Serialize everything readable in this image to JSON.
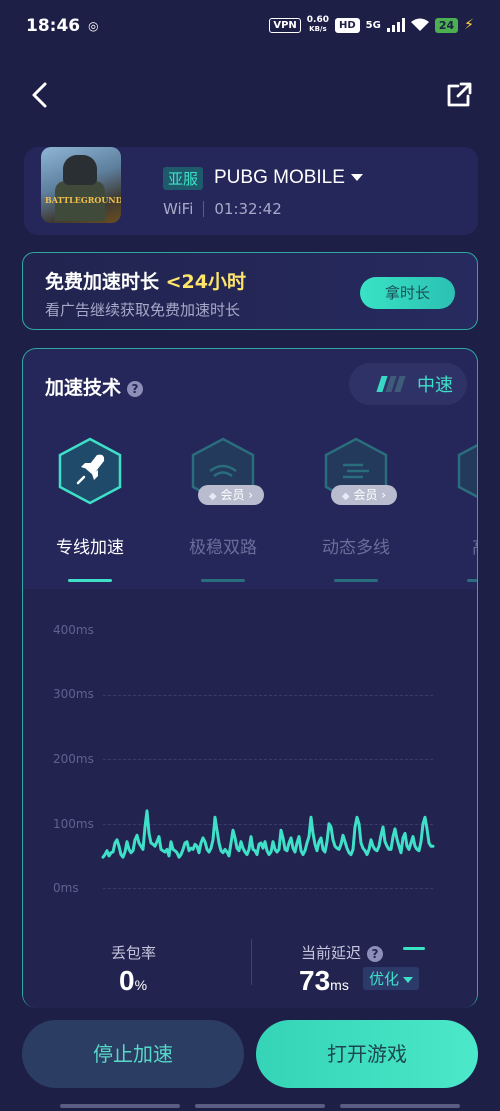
{
  "status_bar": {
    "time": "18:46",
    "vpn": "VPN",
    "net_speed": "0.60",
    "net_unit": "KB/s",
    "hd": "HD",
    "signal": "5G",
    "battery": "24"
  },
  "game": {
    "region": "亚服",
    "name": "PUBG MOBILE",
    "network": "WiFi",
    "duration": "01:32:42",
    "icon_text": "BATTLEGROUNDS"
  },
  "free_time": {
    "title_prefix": "免费加速时长 ",
    "title_highlight": "<24小时",
    "subtitle": "看广告继续获取免费加速时长",
    "button": "拿时长"
  },
  "tech": {
    "title": "加速技术",
    "help": "?",
    "speed_mode": "中速",
    "items": [
      {
        "label": "专线加速"
      },
      {
        "label": "极稳双路",
        "badge": "会员"
      },
      {
        "label": "动态多线",
        "badge": "会员"
      },
      {
        "label": "高速"
      }
    ]
  },
  "chart_data": {
    "type": "line",
    "y_ticks": [
      "400ms",
      "300ms",
      "200ms",
      "100ms",
      "0ms"
    ],
    "ylim": [
      0,
      400
    ],
    "series": [
      {
        "values": [
          48,
          52,
          58,
          50,
          55,
          56,
          70,
          75,
          65,
          52,
          48,
          56,
          72,
          60,
          55,
          58,
          75,
          82,
          70,
          65,
          60,
          95,
          120,
          85,
          70,
          68,
          65,
          72,
          80,
          60,
          58,
          56,
          60,
          50,
          72,
          60,
          58,
          55,
          48,
          52,
          60,
          70,
          72,
          58,
          62,
          60,
          68,
          65,
          55,
          70,
          78,
          72,
          60,
          56,
          62,
          75,
          110,
          90,
          70,
          58,
          55,
          60,
          56,
          50,
          70,
          90,
          78,
          62,
          58,
          72,
          62,
          56,
          52,
          60,
          80,
          60,
          58,
          52,
          68,
          70,
          62,
          72,
          58,
          52,
          56,
          72,
          60,
          56,
          60,
          90,
          78,
          60,
          58,
          70,
          78,
          62,
          56,
          70,
          80,
          58,
          52,
          58,
          70,
          80,
          110,
          85,
          68,
          58,
          72,
          78,
          60,
          56,
          72,
          100,
          95,
          75,
          65,
          62,
          60,
          68,
          82,
          72,
          62,
          55,
          52,
          60,
          95,
          110,
          100,
          70,
          62,
          58,
          52,
          60,
          75,
          65,
          60,
          58,
          65,
          82,
          95,
          72,
          65,
          60,
          60,
          80,
          92,
          76,
          65,
          55,
          78,
          85,
          65,
          60,
          70,
          80,
          65,
          60,
          58,
          72,
          100,
          110,
          92,
          70,
          65,
          65
        ]
      }
    ]
  },
  "stats": {
    "loss_label": "丢包率",
    "loss_value": "0",
    "loss_unit": "%",
    "latency_label": "当前延迟",
    "latency_value": "73",
    "latency_unit": "ms",
    "optimize_label": "优化"
  },
  "buttons": {
    "stop": "停止加速",
    "open": "打开游戏"
  },
  "colors": {
    "accent": "#3ee0c8",
    "background": "#1e1f47",
    "highlight": "#ffe66b"
  }
}
